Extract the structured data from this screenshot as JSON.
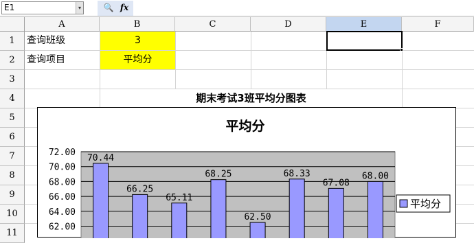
{
  "formula_bar": {
    "name_box": "E1",
    "name_box_arrow": "▾",
    "zoom_glyph": "🔍",
    "fx_label": "fx",
    "formula": ""
  },
  "columns": [
    "A",
    "B",
    "C",
    "D",
    "E",
    "F"
  ],
  "selected_column": "E",
  "rows": [
    "1",
    "2",
    "3",
    "4",
    "5",
    "6",
    "7",
    "8",
    "9",
    "10",
    "11"
  ],
  "cells": {
    "A1": "查询班级",
    "B1": "3",
    "A2": "查询项目",
    "B2": "平均分",
    "title_row4": "期末考试3班平均分图表"
  },
  "colors": {
    "highlight": "#ffff00",
    "plot_area": "#c0c0c0",
    "bar_fill": "#9999ff",
    "selected_header": "#c3d6f0"
  },
  "chart_data": {
    "type": "bar",
    "title": "平均分",
    "series": [
      {
        "name": "平均分",
        "values": [
          70.44,
          66.25,
          65.11,
          68.25,
          62.5,
          68.33,
          67.08,
          68.0
        ],
        "labels": [
          "70.44",
          "66.25",
          "65.11",
          "68.25",
          "62.50",
          "68.33",
          "67.08",
          "68.00"
        ]
      }
    ],
    "yticks": [
      "72.00",
      "70.00",
      "68.00",
      "66.00",
      "64.00",
      "62.00"
    ],
    "yvals": [
      72,
      70,
      68,
      66,
      64,
      62
    ],
    "ylim": [
      60,
      72
    ],
    "grid": true,
    "legend_position": "right"
  }
}
